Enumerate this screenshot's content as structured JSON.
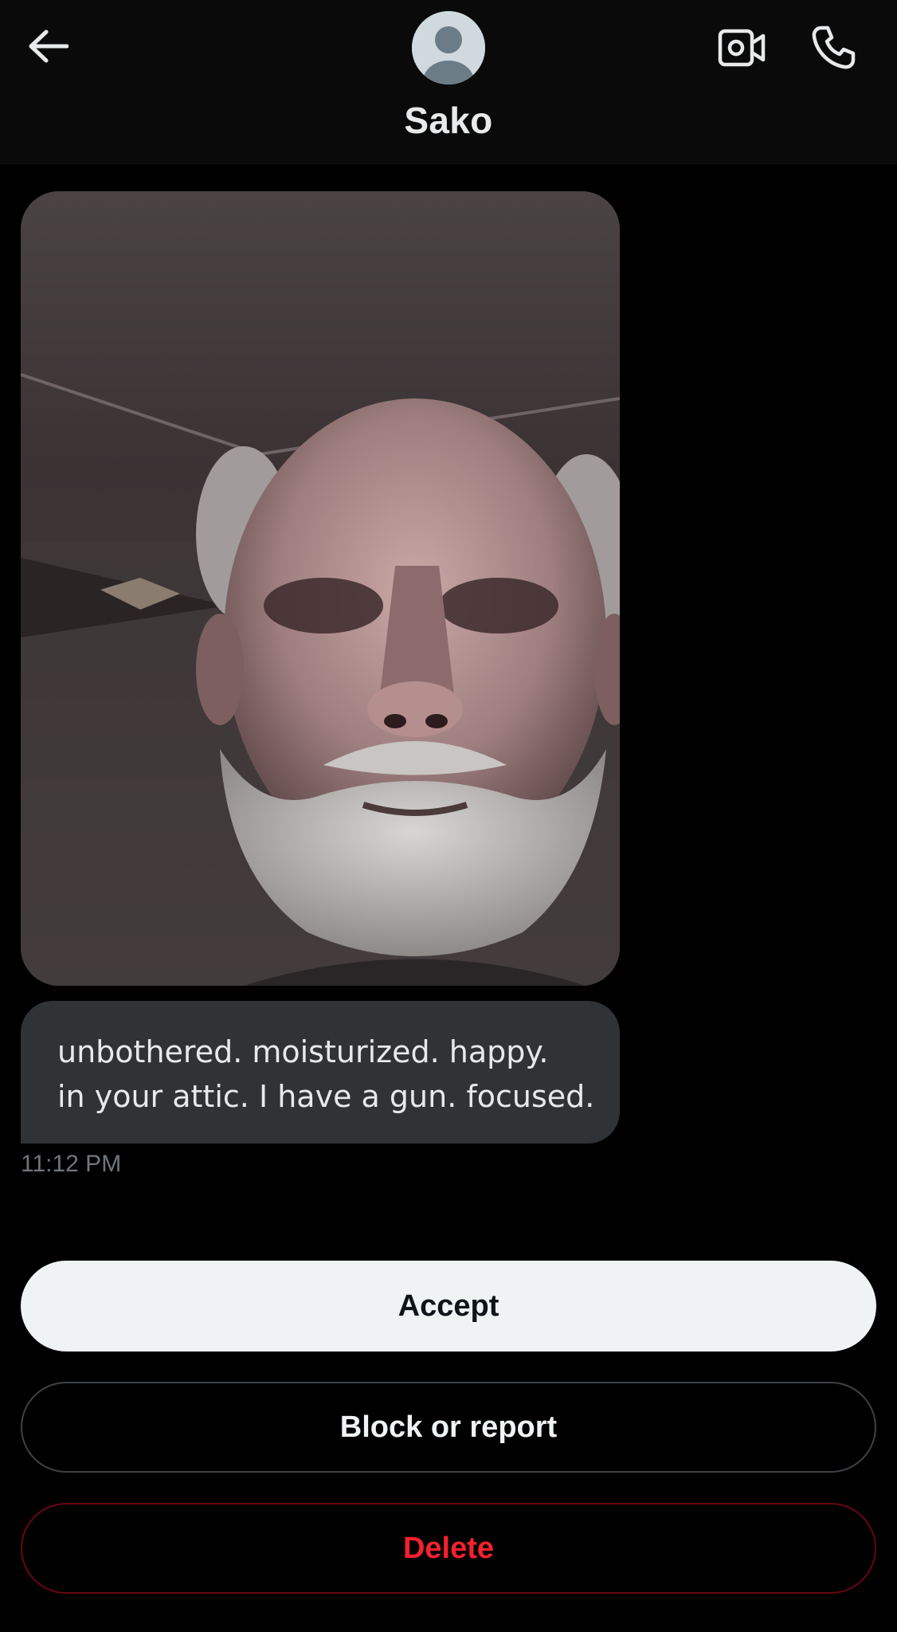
{
  "header": {
    "contact_name": "Sako",
    "back_icon": "arrow-left-icon",
    "video_icon": "video-camera-icon",
    "call_icon": "phone-icon"
  },
  "message": {
    "image_alt": "Photo of an elderly bald man with a white beard, seen from below",
    "lines": [
      "unbothered. moisturized. happy.",
      "in your attic. I have a gun. focused."
    ],
    "timestamp": "11:12 PM"
  },
  "actions": {
    "accept_label": "Accept",
    "block_label": "Block or report",
    "delete_label": "Delete"
  },
  "colors": {
    "background": "#000000",
    "bubble": "#2f3336",
    "accept_bg": "#eff3f4",
    "delete_red": "#f4212e",
    "muted_text": "#71767b"
  }
}
